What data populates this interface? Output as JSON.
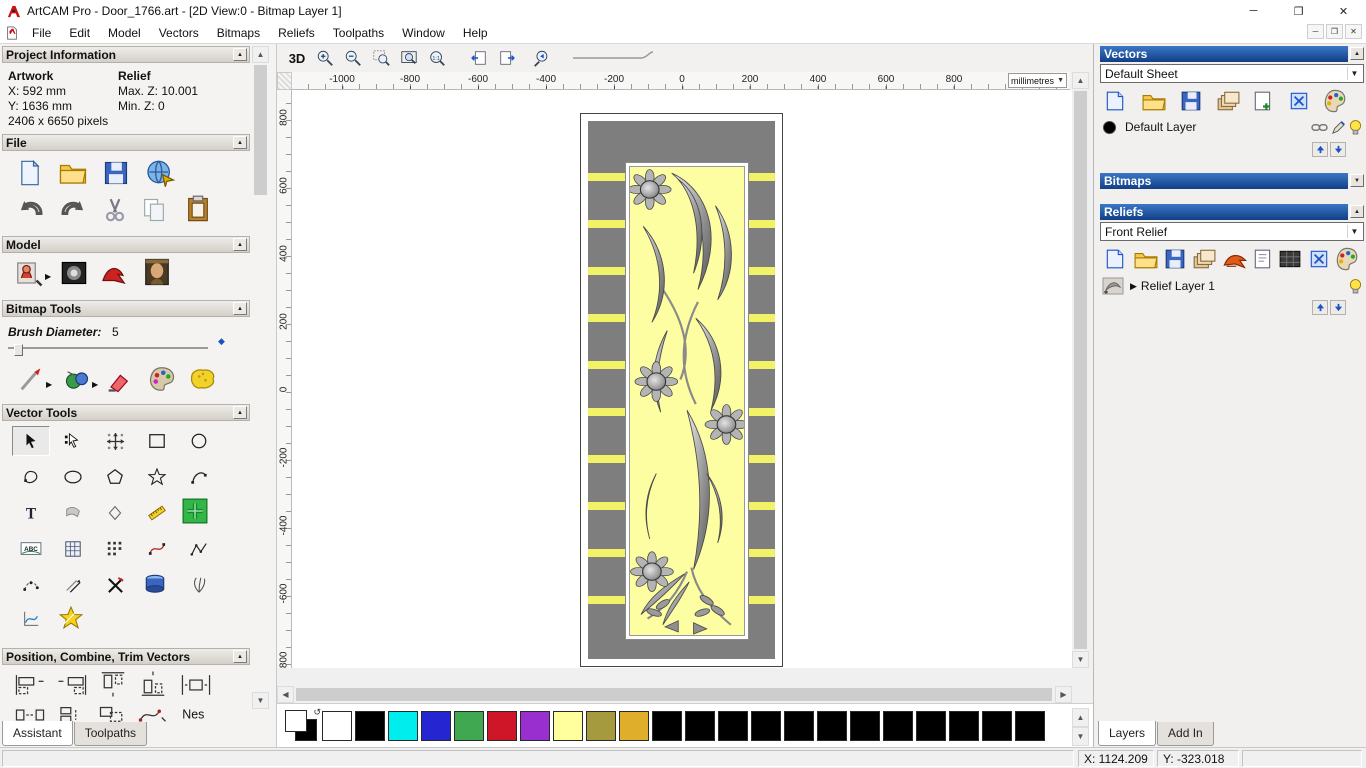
{
  "window": {
    "title": "ArtCAM Pro - Door_1766.art - [2D View:0 - Bitmap Layer 1]"
  },
  "menu": {
    "items": [
      "File",
      "Edit",
      "Model",
      "Vectors",
      "Bitmaps",
      "Reliefs",
      "Toolpaths",
      "Window",
      "Help"
    ]
  },
  "assistant": {
    "project_information": {
      "title": "Project Information",
      "artwork_heading": "Artwork",
      "relief_heading": "Relief",
      "x": "X: 592 mm",
      "y": "Y: 1636 mm",
      "max_z": "Max. Z: 10.001",
      "min_z": "Min. Z: 0",
      "pixels": "2406 x 6650 pixels"
    },
    "file_section": "File",
    "model_section": "Model",
    "bitmap_tools_section": "Bitmap Tools",
    "brush_diameter_label": "Brush Diameter:",
    "brush_diameter_value": "5",
    "vector_tools_section": "Vector Tools",
    "position_section": "Position, Combine, Trim Vectors",
    "nest_tool_label": "Nes",
    "tabs": {
      "assistant": "Assistant",
      "toolpaths": "Toolpaths"
    }
  },
  "view_toolbar": {
    "btn_3d": "3D"
  },
  "ruler": {
    "h_ticks": [
      "-1000",
      "-800",
      "-600",
      "-400",
      "-200",
      "0",
      "200",
      "400",
      "600",
      "800"
    ],
    "v_ticks": [
      "800",
      "600",
      "400",
      "200",
      "0",
      "-200",
      "-400",
      "-600",
      "-800"
    ],
    "units": "millimetres"
  },
  "panels": {
    "vectors": {
      "title": "Vectors",
      "sheet_value": "Default Sheet",
      "layer_name": "Default Layer"
    },
    "bitmaps": {
      "title": "Bitmaps"
    },
    "reliefs": {
      "title": "Reliefs",
      "selected_value": "Front Relief",
      "layer_name": "Relief Layer 1"
    },
    "tabs": {
      "layers": "Layers",
      "addin": "Add In"
    }
  },
  "status_bar": {
    "x": "X: 1124.209",
    "y": "Y: -323.018"
  },
  "palette": {
    "colors": [
      "#ffffff",
      "#000000",
      "#00eded",
      "#2525d2",
      "#3fa850",
      "#cf1628",
      "#9a2fcf",
      "#ffff9e",
      "#a59b3e",
      "#dfae2a",
      "#000000",
      "#000000",
      "#000000",
      "#000000",
      "#000000",
      "#000000",
      "#000000",
      "#000000",
      "#000000",
      "#000000",
      "#000000",
      "#000000"
    ]
  }
}
